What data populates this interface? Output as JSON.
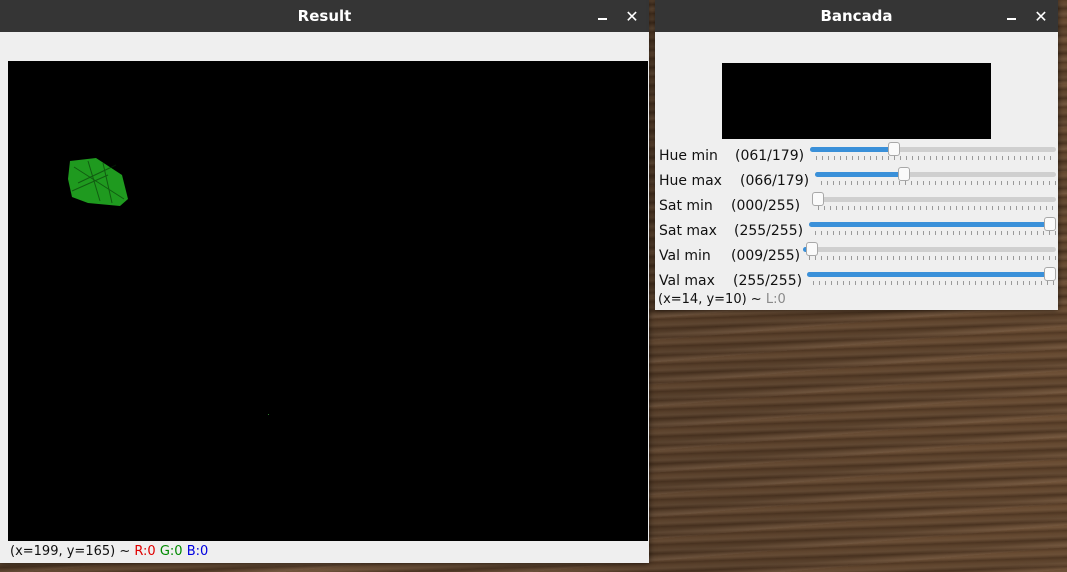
{
  "result_window": {
    "title": "Result",
    "status": {
      "coords": "(x=199, y=165) ~ ",
      "r": "R:0",
      "g": "G:0",
      "b": "B:0"
    }
  },
  "bancada_window": {
    "title": "Bancada",
    "trackbars": [
      {
        "label": "Hue min",
        "value": "(061/179)",
        "level": 61,
        "max": 179
      },
      {
        "label": "Hue max",
        "value": "(066/179)",
        "level": 66,
        "max": 179
      },
      {
        "label": "Sat min",
        "value": "(000/255)",
        "level": 0,
        "max": 255
      },
      {
        "label": "Sat max",
        "value": "(255/255)",
        "level": 255,
        "max": 255
      },
      {
        "label": "Val min",
        "value": "(009/255)",
        "level": 9,
        "max": 255
      },
      {
        "label": "Val max",
        "value": "(255/255)",
        "level": 255,
        "max": 255
      }
    ],
    "status": {
      "coords": "(x=14, y=10) ~ ",
      "l": "L:0"
    }
  },
  "colors": {
    "titlebar": "#353535",
    "slider_fill": "#3a90d9",
    "detected_blob": "#1f9a1f"
  },
  "icons": {
    "minimize": "minimize-icon",
    "close": "close-icon"
  }
}
